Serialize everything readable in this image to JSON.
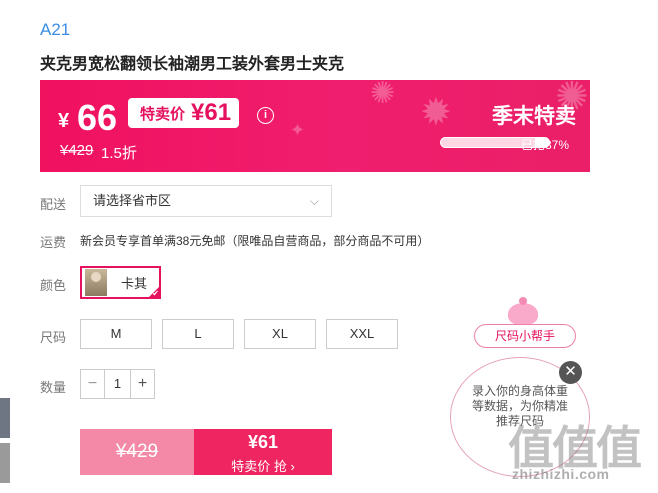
{
  "product": {
    "brand": "A21",
    "title": "夹克男宽松翻领长袖潮男工装外套男士夹克"
  },
  "price": {
    "currency": "¥",
    "price": "66",
    "special_label": "特卖价",
    "special_price": "¥61",
    "info_icon": "info-icon",
    "original": "¥429",
    "discount": "1.5折",
    "season_label": "季末特卖",
    "sold_text": "已抢87%",
    "sold_fraction": 0.87
  },
  "shipping": {
    "label": "配送",
    "select_value": "请选择省市区",
    "chevron_icon": "chevron-down-icon"
  },
  "fee": {
    "label": "运费",
    "text": "新会员专享首单满38元免邮（限唯品自营商品，部分商品不可用）"
  },
  "color": {
    "label": "颜色",
    "option": "卡其",
    "selected": true
  },
  "size": {
    "label": "尺码",
    "options": [
      "M",
      "L",
      "XL",
      "XXL"
    ]
  },
  "quantity": {
    "label": "数量",
    "minus": "−",
    "value": "1",
    "plus": "+"
  },
  "buy": {
    "original": "¥429",
    "price": "¥61",
    "action": "特卖价 抢 ›"
  },
  "helper": {
    "title": "尺码小帮手",
    "text": "录入你的身高体重等数据，为你精准推荐尺码",
    "close_icon": "close-icon"
  },
  "watermark": {
    "logo": "值值值",
    "url": "zhizhizhi.com"
  },
  "colors": {
    "accent": "#e5115e",
    "brand_blue": "#3a8ee6",
    "banner": "#f0115f"
  }
}
